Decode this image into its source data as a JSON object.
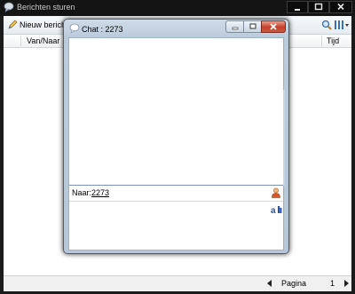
{
  "main_window": {
    "title": "Berichten sturen",
    "toolbar": {
      "new_message_label": "Nieuw bericht"
    },
    "columns": {
      "from_to": "Van/Naar",
      "time": "Tijd"
    },
    "status": {
      "page_label": "Pagina",
      "page_number": "1"
    }
  },
  "chat_window": {
    "title": "Chat : 2273",
    "recipient_label": "Naar:",
    "recipient_value": "2273",
    "spellcheck_glyph": "a"
  },
  "icons": {
    "app": "speech-bubble-icon",
    "new_message": "pencil-icon",
    "search": "magnifier-icon",
    "columns": "columns-icon",
    "recipient_picker": "user-icon",
    "spellcheck": "spellcheck-icon"
  }
}
